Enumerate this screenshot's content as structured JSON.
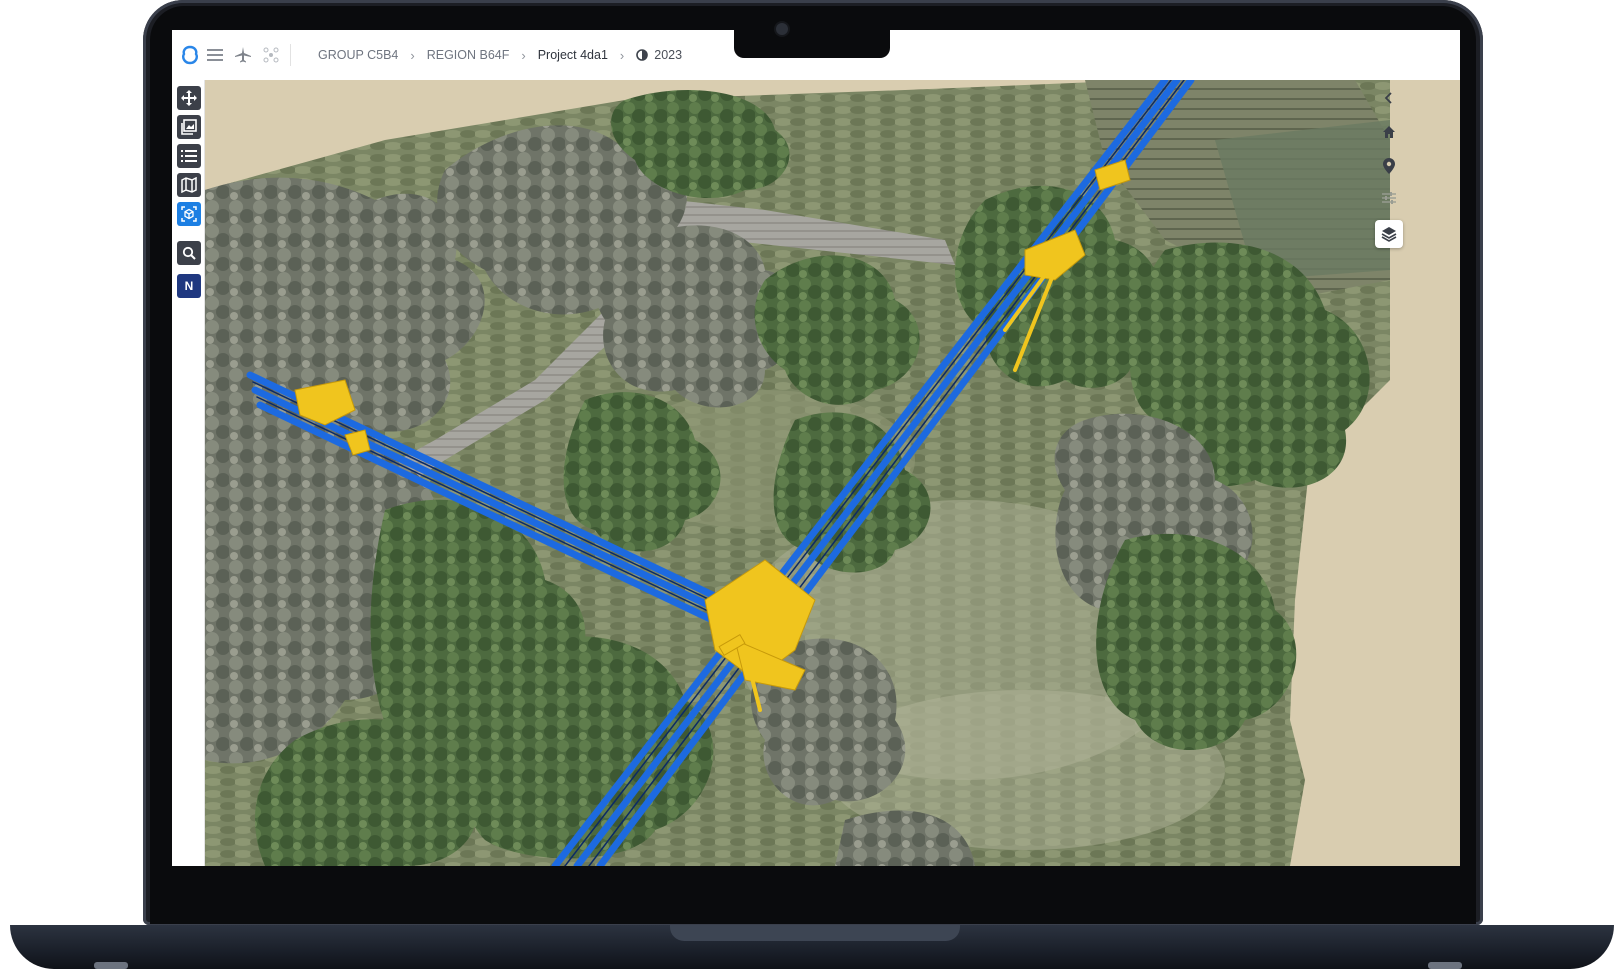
{
  "topbar": {
    "logo_icon": "app-logo-icon",
    "menu_icon": "hamburger-menu-icon",
    "flight_icon": "airplane-icon",
    "drone_icon": "drone-icon",
    "breadcrumbs": {
      "group": "GROUP C5B4",
      "region": "REGION B64F",
      "project": "Project 4da1",
      "year": "2023"
    }
  },
  "left_toolbar": {
    "tools": [
      {
        "name": "move-tool",
        "icon": "move-arrows-icon"
      },
      {
        "name": "gallery-tool",
        "icon": "image-gallery-icon"
      },
      {
        "name": "list-tool",
        "icon": "list-icon"
      },
      {
        "name": "map-tool",
        "icon": "map-icon"
      },
      {
        "name": "3d-view-tool",
        "icon": "3d-scan-icon",
        "active": true
      },
      {
        "name": "search-tool",
        "icon": "search-icon"
      }
    ],
    "north_label": "N"
  },
  "right_controls": {
    "collapse_icon": "chevron-left-icon",
    "home_icon": "home-icon",
    "pin_icon": "map-pin-icon",
    "filter_icon": "sliders-icon",
    "layers_icon": "layers-icon"
  },
  "colors": {
    "accent": "#1c7fe3",
    "north_badge": "#1f3880",
    "powerline": "#1d6ae0",
    "pole": "#f0c51e",
    "terrain_bg": "#d9cdb0"
  }
}
